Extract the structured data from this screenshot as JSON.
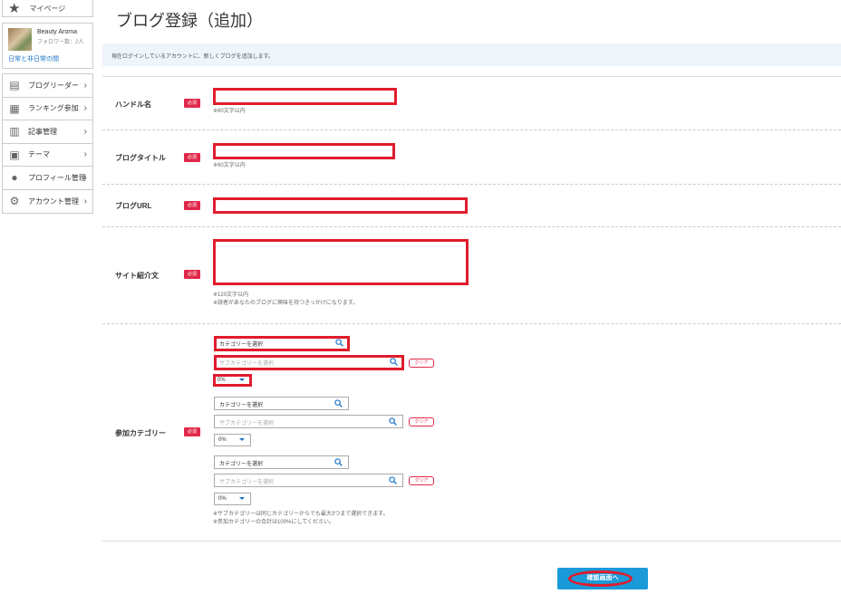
{
  "sidebar": {
    "mypage": "マイページ",
    "profile": {
      "name": "Beauty Aroma",
      "followers": "フォロワー数：2人",
      "blog_link": "日常と非日常の間"
    },
    "items": [
      {
        "label": "ブログリーダー",
        "icon": "blog-reader-icon"
      },
      {
        "label": "ランキング参加",
        "icon": "ranking-icon"
      },
      {
        "label": "記事管理",
        "icon": "article-icon"
      },
      {
        "label": "テーマ",
        "icon": "theme-icon"
      },
      {
        "label": "プロフィール管理",
        "icon": "profile-icon"
      },
      {
        "label": "アカウント管理",
        "icon": "gear-icon"
      }
    ]
  },
  "page": {
    "title": "ブログ登録（追加）",
    "notice": "現在ログインしているアカウントに、新しくブログを追加します。"
  },
  "form": {
    "required": "必須",
    "handle": {
      "label": "ハンドル名",
      "hint": "※60文字以内"
    },
    "blog_title": {
      "label": "ブログタイトル",
      "hint": "※60文字以内"
    },
    "blog_url": {
      "label": "ブログURL"
    },
    "intro": {
      "label": "サイト紹介文",
      "hint1": "※120文字以内",
      "hint2": "※読者があなたのブログに興味を持つきっかけになります。"
    },
    "category": {
      "label": "参加カテゴリー",
      "select_placeholder": "カテゴリーを選択",
      "sub_placeholder": "サブカテゴリーを選択",
      "clear": "クリア",
      "percent": "0%",
      "note1": "※サブカテゴリーは同じカテゴリーからでも最大3つまで選択できます。",
      "note2": "※参加カテゴリーの合計は100%にしてください。"
    }
  },
  "submit": {
    "label": "確認画面へ"
  },
  "colors": {
    "accent": "#1a9ad9",
    "required": "#e0294a",
    "highlight": "#e01c2c"
  }
}
